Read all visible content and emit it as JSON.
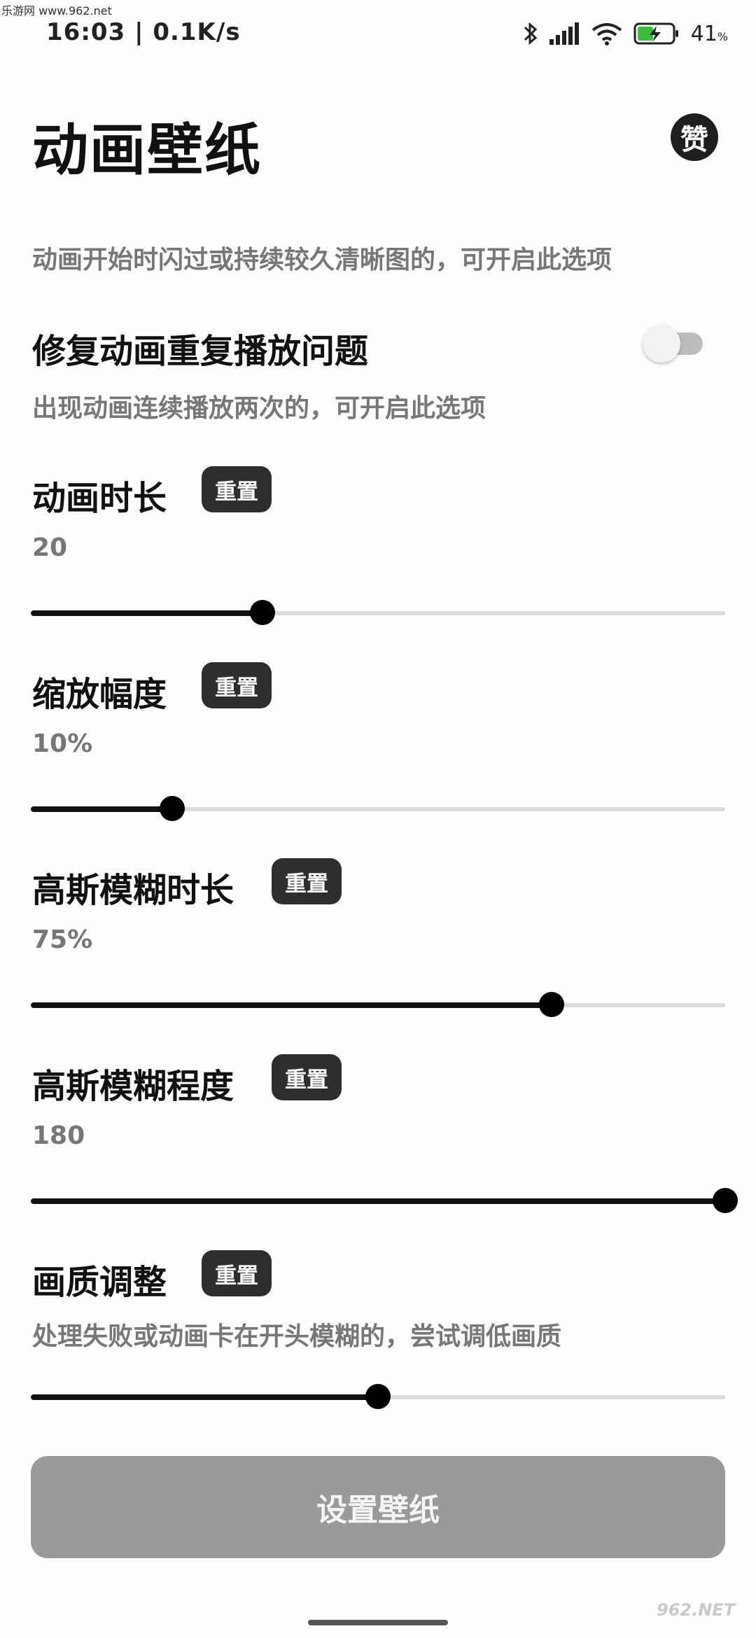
{
  "watermark_top": "乐游网 www.962.net",
  "status_bar": {
    "time": "16:03 | 0.1K/s",
    "battery_level": "41",
    "battery_unit": "%",
    "icons": [
      "bluetooth-icon",
      "signal-icon",
      "wifi-icon",
      "battery-charging-icon"
    ]
  },
  "header": {
    "title": "动画壁纸",
    "like_label": "赞"
  },
  "intro_hint": "动画开始时闪过或持续较久清晰图的，可开启此选项",
  "fix_repeat": {
    "title": "修复动画重复播放问题",
    "hint": "出现动画连续播放两次的，可开启此选项",
    "enabled": false
  },
  "settings": [
    {
      "title": "动画时长",
      "reset_label": "重置",
      "value": "20",
      "level": 0.334
    },
    {
      "title": "缩放幅度",
      "reset_label": "重置",
      "value": "10%",
      "level": 0.204
    },
    {
      "title": "高斯模糊时长",
      "reset_label": "重置",
      "value": "75%",
      "level": 0.75
    },
    {
      "title": "高斯模糊程度",
      "reset_label": "重置",
      "value": "180",
      "level": 1.0
    },
    {
      "title": "画质调整",
      "reset_label": "重置",
      "hint": "处理失败或动画卡在开头模糊的，尝试调低画质",
      "level": 0.5
    }
  ],
  "set_wallpaper_label": "设置壁纸",
  "watermark_bottom": "962.NET",
  "colors": {
    "accent": "#000000",
    "track": "#dcdcdc",
    "button_disabled": "#9a9a9a",
    "reset_button": "#2e2e2e",
    "hint_text": "#777777"
  }
}
